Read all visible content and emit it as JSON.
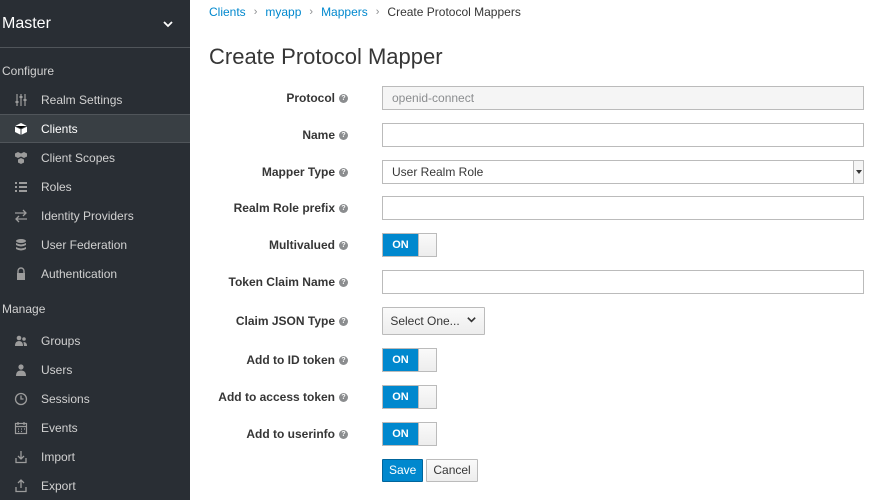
{
  "sidebar": {
    "realm": "Master",
    "configure_title": "Configure",
    "configure_items": [
      {
        "label": "Realm Settings",
        "icon": "sliders-icon"
      },
      {
        "label": "Clients",
        "icon": "cube-icon"
      },
      {
        "label": "Client Scopes",
        "icon": "cubes-icon"
      },
      {
        "label": "Roles",
        "icon": "list-icon"
      },
      {
        "label": "Identity Providers",
        "icon": "exchange-icon"
      },
      {
        "label": "User Federation",
        "icon": "database-icon"
      },
      {
        "label": "Authentication",
        "icon": "lock-icon"
      }
    ],
    "manage_title": "Manage",
    "manage_items": [
      {
        "label": "Groups",
        "icon": "users-icon"
      },
      {
        "label": "Users",
        "icon": "user-icon"
      },
      {
        "label": "Sessions",
        "icon": "clock-icon"
      },
      {
        "label": "Events",
        "icon": "calendar-icon"
      },
      {
        "label": "Import",
        "icon": "import-icon"
      },
      {
        "label": "Export",
        "icon": "export-icon"
      }
    ]
  },
  "breadcrumb": {
    "items": [
      "Clients",
      "myapp",
      "Mappers"
    ],
    "current": "Create Protocol Mappers"
  },
  "page_title": "Create Protocol Mapper",
  "form": {
    "protocol": {
      "label": "Protocol",
      "value": "openid-connect"
    },
    "name": {
      "label": "Name",
      "value": ""
    },
    "mapper_type": {
      "label": "Mapper Type",
      "value": "User Realm Role"
    },
    "realm_role_prefix": {
      "label": "Realm Role prefix",
      "value": ""
    },
    "multivalued": {
      "label": "Multivalued",
      "state": "ON"
    },
    "token_claim_name": {
      "label": "Token Claim Name",
      "value": ""
    },
    "claim_json_type": {
      "label": "Claim JSON Type",
      "value": "Select One..."
    },
    "add_to_id_token": {
      "label": "Add to ID token",
      "state": "ON"
    },
    "add_to_access_token": {
      "label": "Add to access token",
      "state": "ON"
    },
    "add_to_userinfo": {
      "label": "Add to userinfo",
      "state": "ON"
    },
    "help_glyph": "?"
  },
  "actions": {
    "save": "Save",
    "cancel": "Cancel"
  },
  "colors": {
    "sidebar_bg": "#292e34",
    "accent": "#0088ce"
  }
}
